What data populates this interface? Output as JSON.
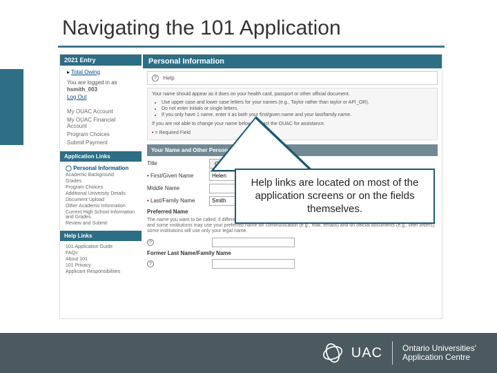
{
  "slide": {
    "title": "Navigating the 101 Application"
  },
  "callout": {
    "text": "Help links are located on most of the application screens or on the fields themselves."
  },
  "screenshot": {
    "entry_header": "2021 Entry",
    "total_owing_label": "Total Owing",
    "login": {
      "line1": "You are logged in as",
      "username": "hsmith_003",
      "logout": "Log Out"
    },
    "quick_links": [
      "My OUAC Account",
      "My OUAC Financial Account",
      "Program Choices",
      "Submit Payment"
    ],
    "app_links_header": "Application Links",
    "app_links": [
      "Personal Information",
      "Academic Background",
      "Grades",
      "Program Choices",
      "Additional University Details",
      "Document Upload",
      "Other Academic Information",
      "Current High School Information and Grades",
      "Review and Submit"
    ],
    "help_links_header": "Help Links",
    "help_links": [
      "101 Application Guide",
      "FAQs",
      "About 101",
      "101 Privacy",
      "Applicant Responsibilities"
    ],
    "main_header": "Personal Information",
    "help_button": "Help",
    "name_note_lead": "Your name should appear as it does on your health card, passport or other official document.",
    "name_note_items": [
      "Use upper case and lower case letters for your names (e.g., Taylor rather than taylor or API_OR).",
      "Do not enter initials or single letters.",
      "If you only have 1 name, enter it as both your first/given name and your last/family name."
    ],
    "name_note_contact": "If you are not able to change your name below, contact the OUAC for assistance.",
    "required_label": "= Required Field",
    "section_your_name": "Your Name and Other Personal Details",
    "fields": {
      "title_label": "Title",
      "title_value": "Choose",
      "first_label": "First/Given Name",
      "first_value": "Helen",
      "middle_label": "Middle Name",
      "middle_value": "",
      "last_label": "Last/Family Name",
      "last_value": "Smith",
      "preferred_label": "Preferred Name",
      "preferred_note": "The name you want to be called, if different from your legal given name. Do not include your last/family name. Note: While the OUAC and some institutions may use your preferred name for communication (e.g., mail, emails) and on official documents (e.g., offer letters), some institutions will use only your legal name.",
      "former_label": "Former Last Name/Family Name"
    }
  },
  "footer": {
    "brand_short": "UAC",
    "brand_line1": "Ontario Universities'",
    "brand_line2": "Application Centre"
  }
}
